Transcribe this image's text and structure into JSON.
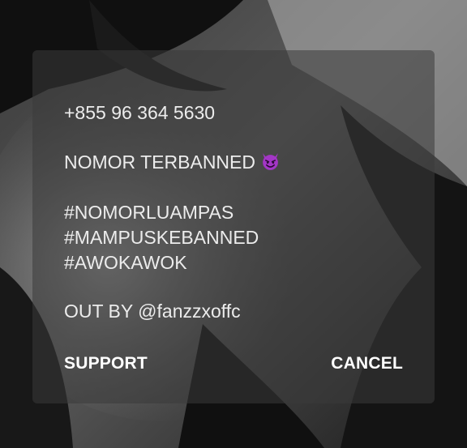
{
  "dialog": {
    "lines": {
      "phone": "+855 96 364 5630",
      "status": "NOMOR TERBANNED",
      "tag1": "#NOMORLUAMPAS",
      "tag2": "#MAMPUSKEBANNED",
      "tag3": "#AWOKAWOK",
      "credit": "OUT BY @fanzzxoffc"
    },
    "status_icon": "smiling-devil-emoji-icon",
    "support_label": "SUPPORT",
    "cancel_label": "CANCEL"
  },
  "colors": {
    "text": "#ececec",
    "button_text": "#ffffff",
    "devil_emoji": "#a336c6",
    "dialog_background": "rgba(58,58,58,0.55)"
  }
}
